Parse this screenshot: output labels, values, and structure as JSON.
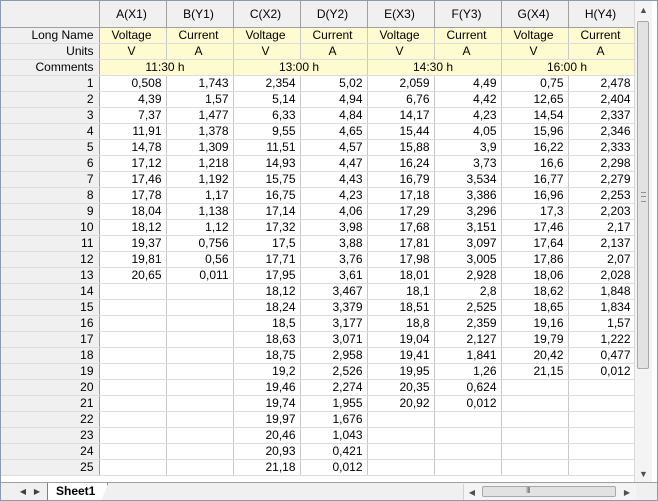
{
  "columns": [
    {
      "header": "A(X1)",
      "long_name": "Voltage",
      "units": "V"
    },
    {
      "header": "B(Y1)",
      "long_name": "Current",
      "units": "A"
    },
    {
      "header": "C(X2)",
      "long_name": "Voltage",
      "units": "V"
    },
    {
      "header": "D(Y2)",
      "long_name": "Current",
      "units": "A"
    },
    {
      "header": "E(X3)",
      "long_name": "Voltage",
      "units": "V"
    },
    {
      "header": "F(Y3)",
      "long_name": "Current",
      "units": "A"
    },
    {
      "header": "G(X4)",
      "long_name": "Voltage",
      "units": "V"
    },
    {
      "header": "H(Y4)",
      "long_name": "Current",
      "units": "A"
    }
  ],
  "row_labels": {
    "long_name": "Long Name",
    "units": "Units",
    "comments": "Comments"
  },
  "comments": [
    "11:30 h",
    "13:00 h",
    "14:30 h",
    "16:00 h"
  ],
  "rows": [
    {
      "n": "1",
      "v": [
        "0,508",
        "1,743",
        "2,354",
        "5,02",
        "2,059",
        "4,49",
        "0,75",
        "2,478"
      ]
    },
    {
      "n": "2",
      "v": [
        "4,39",
        "1,57",
        "5,14",
        "4,94",
        "6,76",
        "4,42",
        "12,65",
        "2,404"
      ]
    },
    {
      "n": "3",
      "v": [
        "7,37",
        "1,477",
        "6,33",
        "4,84",
        "14,17",
        "4,23",
        "14,54",
        "2,337"
      ]
    },
    {
      "n": "4",
      "v": [
        "11,91",
        "1,378",
        "9,55",
        "4,65",
        "15,44",
        "4,05",
        "15,96",
        "2,346"
      ]
    },
    {
      "n": "5",
      "v": [
        "14,78",
        "1,309",
        "11,51",
        "4,57",
        "15,88",
        "3,9",
        "16,22",
        "2,333"
      ]
    },
    {
      "n": "6",
      "v": [
        "17,12",
        "1,218",
        "14,93",
        "4,47",
        "16,24",
        "3,73",
        "16,6",
        "2,298"
      ]
    },
    {
      "n": "7",
      "v": [
        "17,46",
        "1,192",
        "15,75",
        "4,43",
        "16,79",
        "3,534",
        "16,77",
        "2,279"
      ]
    },
    {
      "n": "8",
      "v": [
        "17,78",
        "1,17",
        "16,75",
        "4,23",
        "17,18",
        "3,386",
        "16,96",
        "2,253"
      ]
    },
    {
      "n": "9",
      "v": [
        "18,04",
        "1,138",
        "17,14",
        "4,06",
        "17,29",
        "3,296",
        "17,3",
        "2,203"
      ]
    },
    {
      "n": "10",
      "v": [
        "18,12",
        "1,12",
        "17,32",
        "3,98",
        "17,68",
        "3,151",
        "17,46",
        "2,17"
      ]
    },
    {
      "n": "11",
      "v": [
        "19,37",
        "0,756",
        "17,5",
        "3,88",
        "17,81",
        "3,097",
        "17,64",
        "2,137"
      ]
    },
    {
      "n": "12",
      "v": [
        "19,81",
        "0,56",
        "17,71",
        "3,76",
        "17,98",
        "3,005",
        "17,86",
        "2,07"
      ]
    },
    {
      "n": "13",
      "v": [
        "20,65",
        "0,011",
        "17,95",
        "3,61",
        "18,01",
        "2,928",
        "18,06",
        "2,028"
      ]
    },
    {
      "n": "14",
      "v": [
        "",
        "",
        "18,12",
        "3,467",
        "18,1",
        "2,8",
        "18,62",
        "1,848"
      ]
    },
    {
      "n": "15",
      "v": [
        "",
        "",
        "18,24",
        "3,379",
        "18,51",
        "2,525",
        "18,65",
        "1,834"
      ]
    },
    {
      "n": "16",
      "v": [
        "",
        "",
        "18,5",
        "3,177",
        "18,8",
        "2,359",
        "19,16",
        "1,57"
      ]
    },
    {
      "n": "17",
      "v": [
        "",
        "",
        "18,63",
        "3,071",
        "19,04",
        "2,127",
        "19,79",
        "1,222"
      ]
    },
    {
      "n": "18",
      "v": [
        "",
        "",
        "18,75",
        "2,958",
        "19,41",
        "1,841",
        "20,42",
        "0,477"
      ]
    },
    {
      "n": "19",
      "v": [
        "",
        "",
        "19,2",
        "2,526",
        "19,95",
        "1,26",
        "21,15",
        "0,012"
      ]
    },
    {
      "n": "20",
      "v": [
        "",
        "",
        "19,46",
        "2,274",
        "20,35",
        "0,624",
        "",
        ""
      ]
    },
    {
      "n": "21",
      "v": [
        "",
        "",
        "19,74",
        "1,955",
        "20,92",
        "0,012",
        "",
        ""
      ]
    },
    {
      "n": "22",
      "v": [
        "",
        "",
        "19,97",
        "1,676",
        "",
        "",
        "",
        ""
      ]
    },
    {
      "n": "23",
      "v": [
        "",
        "",
        "20,46",
        "1,043",
        "",
        "",
        "",
        ""
      ]
    },
    {
      "n": "24",
      "v": [
        "",
        "",
        "20,93",
        "0,421",
        "",
        "",
        "",
        ""
      ]
    },
    {
      "n": "25",
      "v": [
        "",
        "",
        "21,18",
        "0,012",
        "",
        "",
        "",
        ""
      ]
    }
  ],
  "sheet_tab": "Sheet1",
  "icons": {
    "scroll_up": "triangle-up-icon",
    "scroll_down": "triangle-down-icon",
    "scroll_left": "triangle-left-icon",
    "scroll_right": "triangle-right-icon"
  },
  "colors": {
    "meta_bg": "#fffbd0",
    "header_bg": "#f0f0f0"
  }
}
